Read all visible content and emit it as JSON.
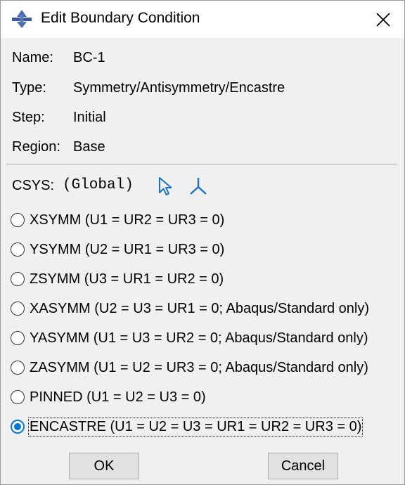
{
  "window": {
    "title": "Edit Boundary Condition",
    "icon": "abaqus-dialog-icon",
    "close_icon": "close-icon"
  },
  "fields": [
    {
      "label": "Name:",
      "value": "BC-1"
    },
    {
      "label": "Type:",
      "value": "Symmetry/Antisymmetry/Encastre"
    },
    {
      "label": "Step:",
      "value": "Initial"
    },
    {
      "label": "Region:",
      "value": "Base"
    }
  ],
  "csys": {
    "label": "CSYS:",
    "value": "(Global)",
    "pick_icon": "select-arrow-icon",
    "create_icon": "coordinate-system-icon"
  },
  "options": [
    {
      "text": "XSYMM (U1 = UR2 = UR3 = 0)",
      "selected": false
    },
    {
      "text": "YSYMM (U2 = UR1 = UR3 = 0)",
      "selected": false
    },
    {
      "text": "ZSYMM (U3 = UR1 = UR2 = 0)",
      "selected": false
    },
    {
      "text": "XASYMM (U2 = U3 = UR1 = 0; Abaqus/Standard only)",
      "selected": false
    },
    {
      "text": "YASYMM (U1 = U3 = UR2 = 0; Abaqus/Standard only)",
      "selected": false
    },
    {
      "text": "ZASYMM (U1 = U2 = UR3 = 0; Abaqus/Standard only)",
      "selected": false
    },
    {
      "text": "PINNED (U1 = U2 = U3 = 0)",
      "selected": false
    },
    {
      "text": "ENCASTRE (U1 = U2 = U3 = UR1 = UR2 = UR3 = 0)",
      "selected": true
    }
  ],
  "buttons": {
    "ok": "OK",
    "cancel": "Cancel"
  },
  "colors": {
    "accent": "#0078d7",
    "icon_blue": "#1a73c8",
    "dialog_bg": "#f0f0f0"
  }
}
